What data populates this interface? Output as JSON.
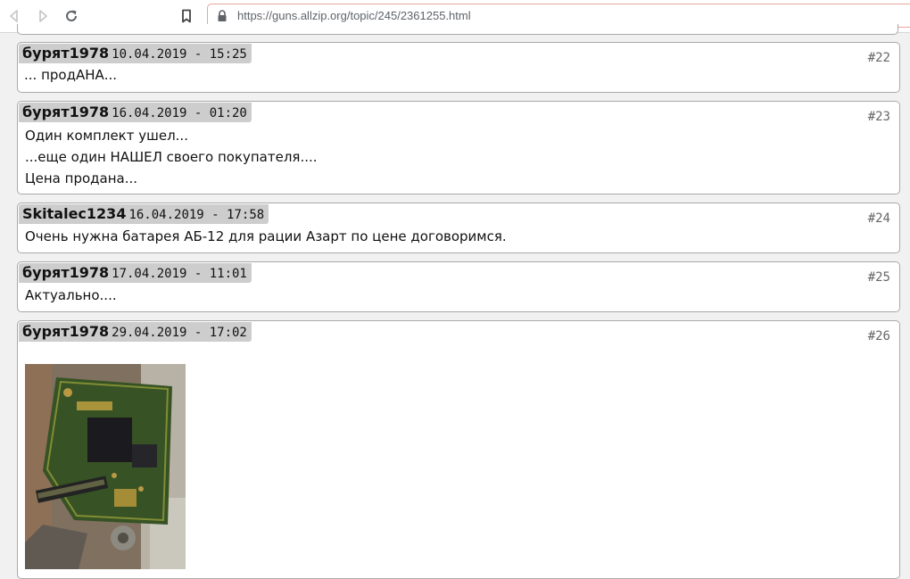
{
  "browser": {
    "url": "https://guns.allzip.org/topic/245/2361255.html"
  },
  "colors": {
    "header_bg": "#cdcdcd",
    "post_border": "#a9a9a9",
    "url_border": "#e7a79d"
  },
  "icons": {
    "back": "back-arrow-icon",
    "forward": "forward-arrow-icon",
    "reload": "reload-icon",
    "bookmark": "bookmark-icon",
    "lock": "lock-icon"
  },
  "posts": [
    {
      "author": "бурят1978",
      "date": "10.04.2019 - 15:25",
      "number": "#22",
      "lines": [
        "... продАНА..."
      ]
    },
    {
      "author": "бурят1978",
      "date": "16.04.2019 - 01:20",
      "number": "#23",
      "lines": [
        "Один комплект ушел...",
        "...еще один НАШЕЛ своего покупателя....",
        "Цена продана..."
      ]
    },
    {
      "author": "Skitalec1234",
      "date": "16.04.2019 - 17:58",
      "number": "#24",
      "lines": [
        "Очень нужна батарея АБ-12 для рации Азарт по цене договоримся."
      ]
    },
    {
      "author": "бурят1978",
      "date": "17.04.2019 - 11:01",
      "number": "#25",
      "lines": [
        "Актуально...."
      ]
    },
    {
      "author": "бурят1978",
      "date": "29.04.2019 - 17:02",
      "number": "#26",
      "lines": []
    }
  ]
}
